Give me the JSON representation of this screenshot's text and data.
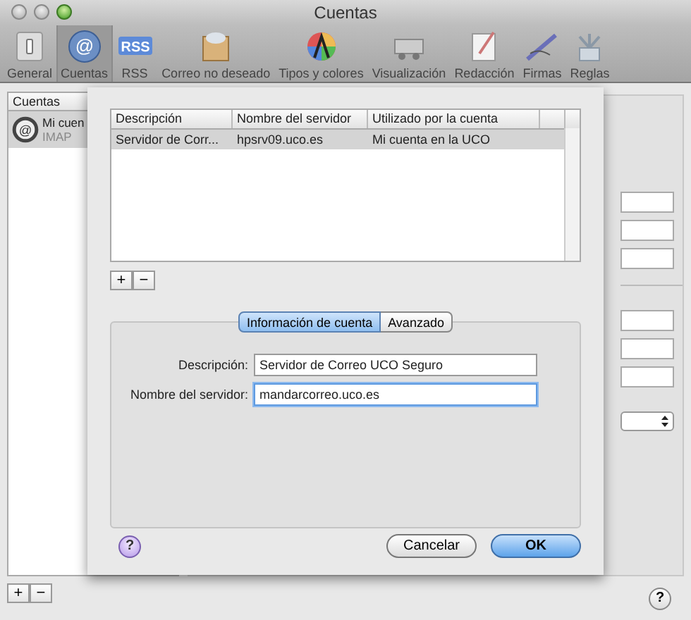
{
  "window": {
    "title": "Cuentas"
  },
  "toolbar": [
    {
      "label": "General",
      "selected": false
    },
    {
      "label": "Cuentas",
      "selected": true,
      "icon_text": "@"
    },
    {
      "label": "RSS",
      "selected": false,
      "icon_text": "RSS"
    },
    {
      "label": "Correo no deseado",
      "selected": false
    },
    {
      "label": "Tipos y colores",
      "selected": false
    },
    {
      "label": "Visualización",
      "selected": false
    },
    {
      "label": "Redacción",
      "selected": false
    },
    {
      "label": "Firmas",
      "selected": false
    },
    {
      "label": "Reglas",
      "selected": false
    }
  ],
  "accounts": {
    "header": "Cuentas",
    "items": [
      {
        "name": "Mi cuen",
        "type": "IMAP",
        "selected": true,
        "icon_text": "@"
      }
    ],
    "add": "+",
    "remove": "−",
    "help": "?"
  },
  "sheet": {
    "table": {
      "columns": [
        "Descripción",
        "Nombre del servidor",
        "Utilizado por la cuenta"
      ],
      "rows": [
        {
          "cells": [
            "Servidor de Corr...",
            "hpsrv09.uco.es",
            "Mi cuenta en la UCO"
          ],
          "selected": true
        }
      ]
    },
    "add": "+",
    "remove": "−",
    "help": "?",
    "tabs": [
      {
        "label": "Información de cuenta",
        "selected": true
      },
      {
        "label": "Avanzado",
        "selected": false
      }
    ],
    "fields": [
      {
        "label": "Descripción:",
        "value": "Servidor de Correo UCO Seguro",
        "focused": false
      },
      {
        "label": "Nombre del servidor:",
        "value": "mandarcorreo.uco.es",
        "focused": true
      }
    ],
    "buttons": [
      {
        "label": "Cancelar",
        "kind": "cancel"
      },
      {
        "label": "OK",
        "kind": "default"
      }
    ]
  }
}
